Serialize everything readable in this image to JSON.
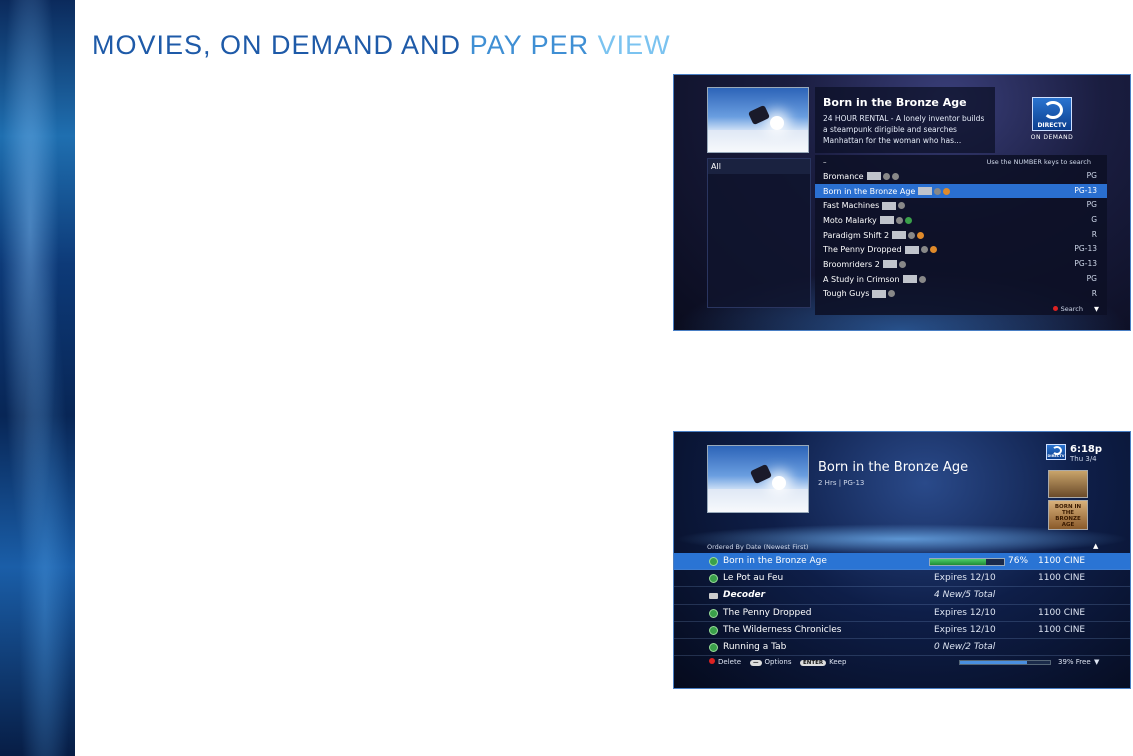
{
  "page_title": {
    "part1": "MOVIES, ON DEMAND AND ",
    "part2": "PAY PER ",
    "part3": "VIEW"
  },
  "colors": {
    "accent_dark": "#1e5aa8",
    "accent_mid": "#3f8fd4",
    "accent_light": "#7bc3f0",
    "selection": "#2a6fd0"
  },
  "on_demand": {
    "category": "All",
    "info_title": "Born in the Bronze Age",
    "info_desc": "24 HOUR RENTAL - A lonely inventor builds a steampunk dirigible and searches Manhattan for the woman who has...",
    "logo_word": "DIRECTV",
    "logo_sub": "ON DEMAND",
    "list_dash": "–",
    "list_hint": "Use the NUMBER keys to search",
    "rows": [
      {
        "title": "Bromance",
        "rating": "PG"
      },
      {
        "title": "Born in the Bronze Age",
        "rating": "PG-13"
      },
      {
        "title": "Fast Machines",
        "rating": "PG"
      },
      {
        "title": "Moto Malarky",
        "rating": "G"
      },
      {
        "title": "Paradigm Shift 2",
        "rating": "R"
      },
      {
        "title": "The Penny Dropped",
        "rating": "PG-13"
      },
      {
        "title": "Broomriders 2",
        "rating": "PG-13"
      },
      {
        "title": "A Study in Crimson",
        "rating": "PG"
      },
      {
        "title": "Tough Guys",
        "rating": "R"
      }
    ],
    "search_label": "Search",
    "scroll_arrow": "▼"
  },
  "playlist": {
    "title": "Born in the Bronze Age",
    "subinfo": "2 Hrs  |  PG-13",
    "logo_word": "DIRECTV",
    "clock": "6:18p",
    "day": "Thu 3/4",
    "poster_text": "BORN IN THE BRONZE AGE",
    "sort_label": "Ordered By Date (Newest First)",
    "up_arrow": "▲",
    "rows": [
      {
        "title": "Born in the Bronze Age",
        "status": "76%",
        "progress": 0.76,
        "channel": "1100 CINE"
      },
      {
        "title": "Le Pot au Feu",
        "status": "Expires 12/10",
        "channel": "1100 CINE"
      },
      {
        "title": "Decoder",
        "status": "4 New/5 Total",
        "channel": ""
      },
      {
        "title": "The Penny Dropped",
        "status": "Expires 12/10",
        "channel": "1100 CINE"
      },
      {
        "title": "The Wilderness Chronicles",
        "status": "Expires 12/10",
        "channel": "1100 CINE"
      },
      {
        "title": "Running a Tab",
        "status": "0 New/2 Total",
        "channel": ""
      }
    ],
    "footer": {
      "delete": "Delete",
      "options_key": "—",
      "options": "Options",
      "enter_key": "ENTER",
      "keep": "Keep",
      "free_fraction": 0.39,
      "free": "39% Free",
      "down_arrow": "▼"
    }
  }
}
